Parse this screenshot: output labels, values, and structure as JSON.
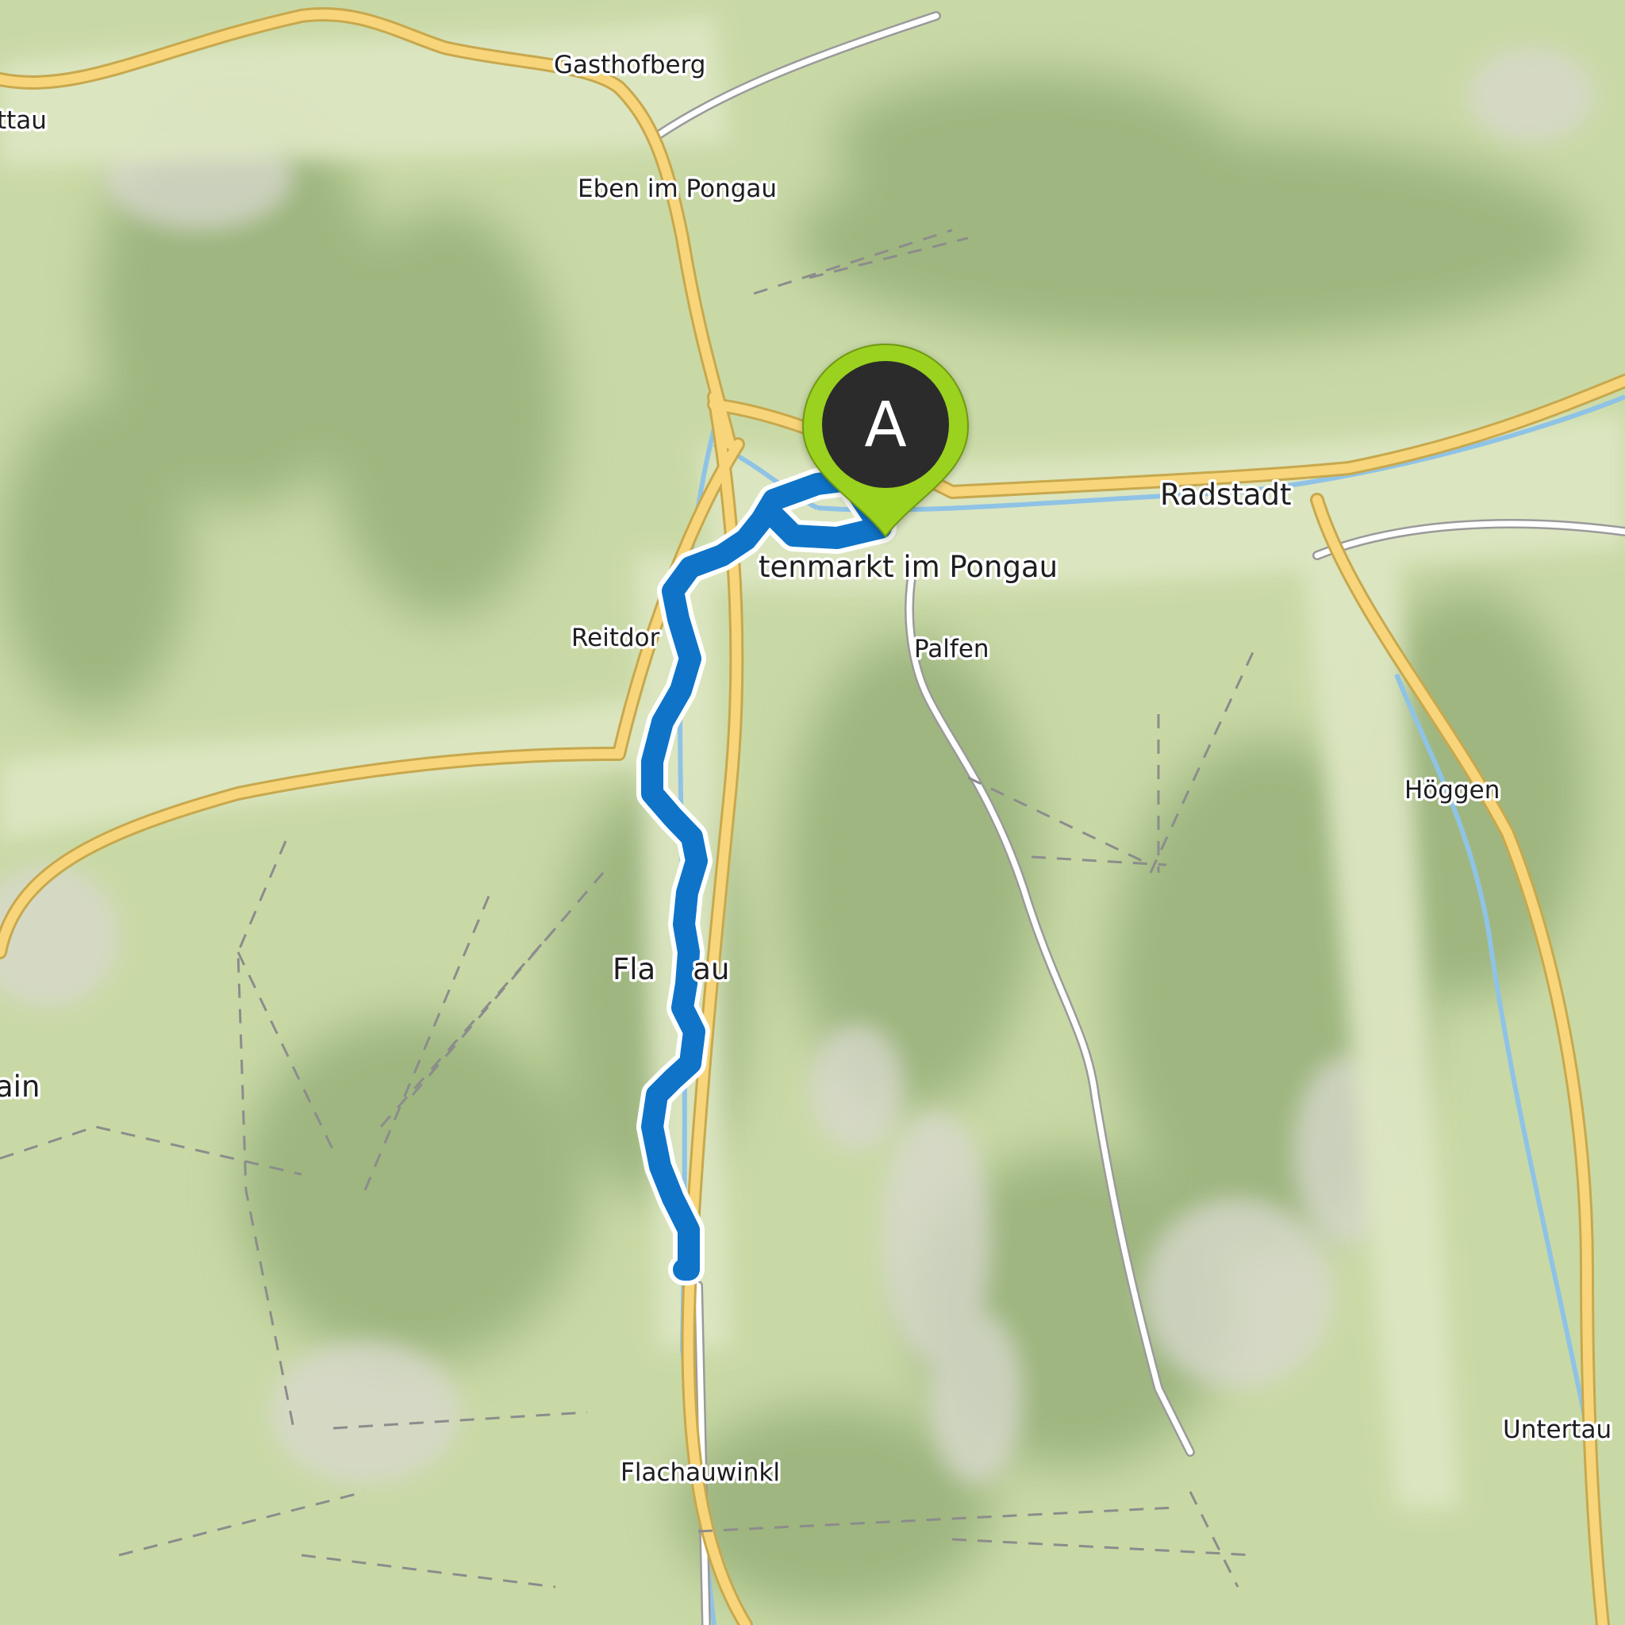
{
  "map": {
    "place_labels": [
      {
        "id": "gasthofberg",
        "text": "Gasthofberg"
      },
      {
        "id": "ttau",
        "text": "ttau"
      },
      {
        "id": "eben",
        "text": "Eben im Pongau"
      },
      {
        "id": "radstadt",
        "text": "Radstadt"
      },
      {
        "id": "altenmarkt",
        "text": "tenmarkt im Pongau"
      },
      {
        "id": "reitdorf",
        "text": "Reitdor"
      },
      {
        "id": "palfen",
        "text": "Palfen"
      },
      {
        "id": "hoggen",
        "text": "Höggen"
      },
      {
        "id": "flachau",
        "text": "Fla    au"
      },
      {
        "id": "ain",
        "text": "ain"
      },
      {
        "id": "untertauern",
        "text": "Untertau"
      },
      {
        "id": "flachauwinkl",
        "text": "Flachauwinkl"
      }
    ],
    "route": {
      "color": "#0f74c8",
      "outline_color": "#ffffff"
    },
    "start_marker": {
      "letter": "A",
      "pin_color": "#9bd21f",
      "inner_color": "#2b2b2b"
    },
    "colors": {
      "terrain": "#c9d9a6",
      "valley": "#dde6c2",
      "major_road": "#f8d57a",
      "road_edge": "#c7a84d",
      "minor_road": "#ffffff",
      "river": "#8fc3e6",
      "lift_line": "#8c8c8c"
    }
  }
}
